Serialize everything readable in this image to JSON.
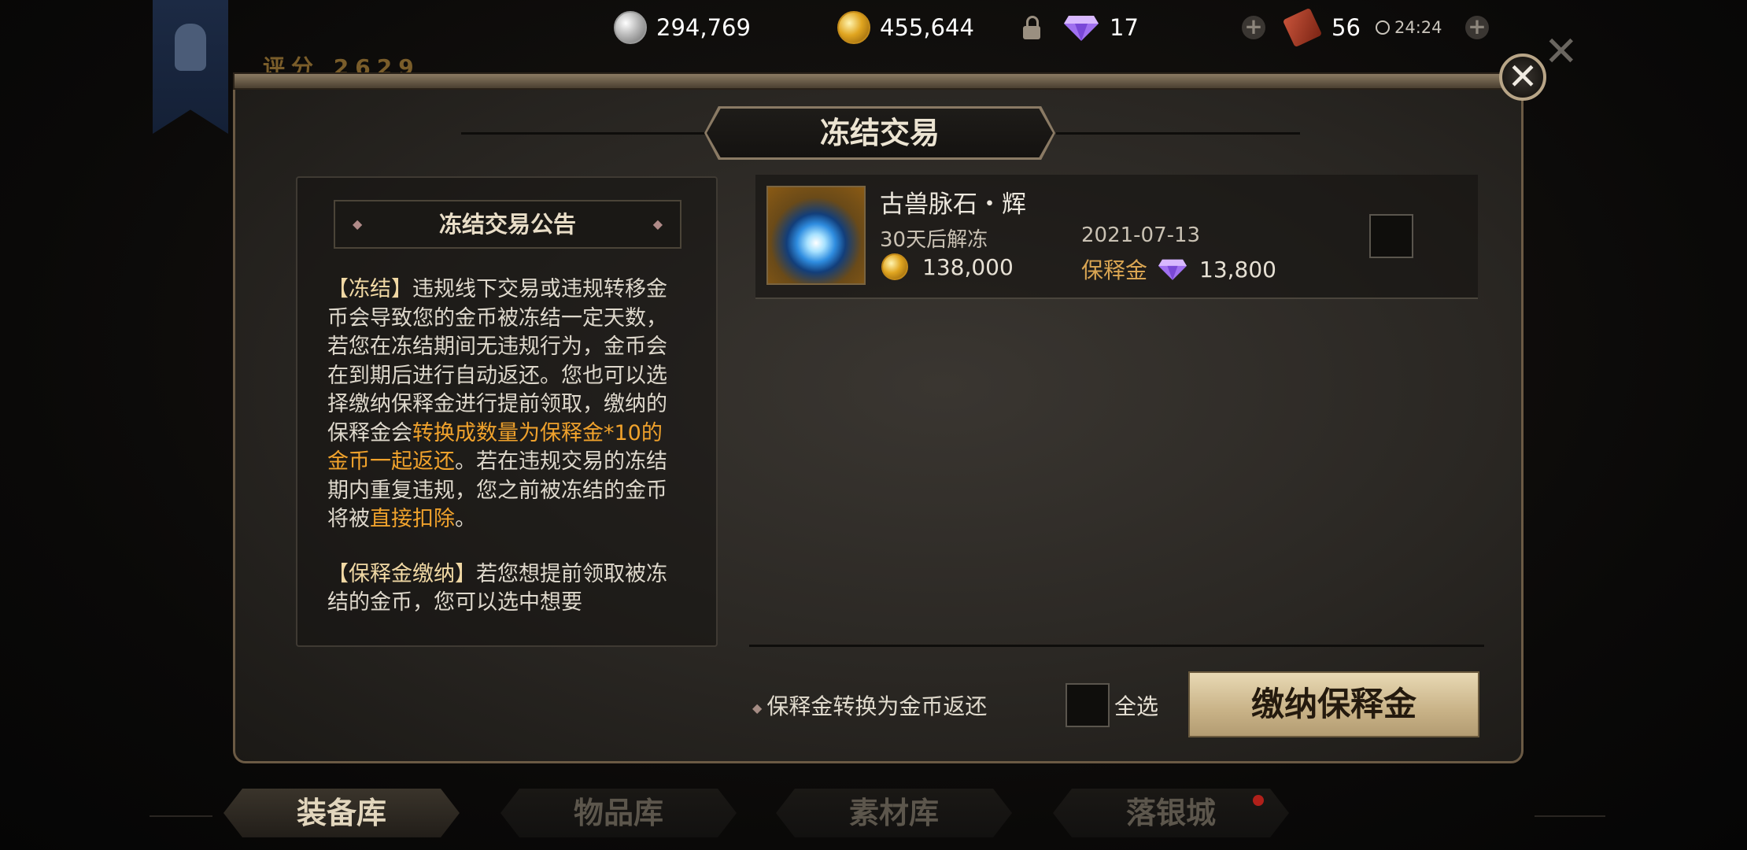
{
  "top_bar": {
    "silver": "294,769",
    "gold": "455,644",
    "diamond": "17",
    "ticket": "56",
    "timer": "24:24"
  },
  "background": {
    "score_label": "评分",
    "score_value": "2629"
  },
  "dialog": {
    "title": "冻结交易",
    "notice": {
      "heading": "冻结交易公告",
      "p1_bracket": "【冻结】",
      "p1_a": "违规线下交易或违规转移金币会导致您的金币被冻结一定天数，若您在冻结期间无违规行为，金币会在到期后进行自动返还。您也可以选择缴纳保释金进行提前领取，缴纳的保释金会",
      "p1_hl1": "转换成数量为保释金*10的金币一起返还",
      "p1_b": "。若在违规交易的冻结期内重复违规，您之前被冻结的金币将被",
      "p1_hl2": "直接扣除",
      "p1_c": "。",
      "p2_bracket": "【保释金缴纳】",
      "p2_a": "若您想提前领取被冻结的金币，您可以选中想要"
    },
    "item": {
      "name": "古兽脉石・辉",
      "unfreeze": "30天后解冻",
      "date": "2021-07-13",
      "amount": "138,000",
      "deposit_label": "保释金",
      "deposit_value": "13,800"
    },
    "footer_note": "保释金转换为金币返还",
    "select_all": "全选",
    "pay_button": "缴纳保释金"
  },
  "tabs": [
    "装备库",
    "物品库",
    "素材库",
    "落银城"
  ],
  "colors": {
    "highlight": "#f0a22c",
    "deposit_label": "#d9a552",
    "panel_border": "#6b5a44"
  }
}
